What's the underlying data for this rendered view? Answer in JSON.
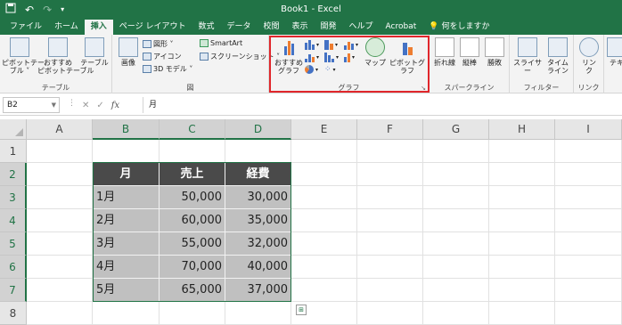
{
  "window": {
    "title": "Book1  -  Excel"
  },
  "tabs": [
    {
      "label": "ファイル"
    },
    {
      "label": "ホーム"
    },
    {
      "label": "挿入",
      "active": true
    },
    {
      "label": "ページ レイアウト"
    },
    {
      "label": "数式"
    },
    {
      "label": "データ"
    },
    {
      "label": "校閲"
    },
    {
      "label": "表示"
    },
    {
      "label": "開発"
    },
    {
      "label": "ヘルプ"
    },
    {
      "label": "Acrobat"
    },
    {
      "label": "何をしますか"
    }
  ],
  "ribbon": {
    "tables": {
      "label": "テーブル",
      "pivot": "ピボットテー\nブル ˅",
      "recommended_pivot": "おすすめ\nピボットテーブル",
      "table": "テーブル"
    },
    "illustrations": {
      "label": "図",
      "image": "画像",
      "shapes": "図形 ˅",
      "icons": "アイコン",
      "model3d": "3D モデル ˅",
      "smartart": "SmartArt",
      "screenshot": "スクリーンショット ˅"
    },
    "charts": {
      "label": "グラフ",
      "recommended": "おすすめ\nグラフ",
      "map": "マップ",
      "pivot_chart": "ピボットグラフ"
    },
    "sparklines": {
      "label": "スパークライン",
      "line": "折れ線",
      "column": "縦棒",
      "winloss": "勝敗"
    },
    "filters": {
      "label": "フィルター",
      "slicer": "スライサー",
      "timeline": "タイム\nライン"
    },
    "links": {
      "label": "リンク",
      "link": "リン\nク"
    },
    "text": {
      "label": "テキ"
    }
  },
  "formula_bar": {
    "name_box": "B2",
    "fx": "fx",
    "formula": "月"
  },
  "sheet": {
    "columns": [
      "A",
      "B",
      "C",
      "D",
      "E",
      "F",
      "G",
      "H",
      "I"
    ],
    "rows": [
      "1",
      "2",
      "3",
      "4",
      "5",
      "6",
      "7",
      "8"
    ],
    "selected_columns": [
      "B",
      "C",
      "D"
    ],
    "selected_rows": [
      "2",
      "3",
      "4",
      "5",
      "6",
      "7"
    ],
    "table": {
      "headers": [
        "月",
        "売上",
        "経費"
      ],
      "rows": [
        [
          "1月",
          "50,000",
          "30,000"
        ],
        [
          "2月",
          "60,000",
          "35,000"
        ],
        [
          "3月",
          "55,000",
          "32,000"
        ],
        [
          "4月",
          "70,000",
          "40,000"
        ],
        [
          "5月",
          "65,000",
          "37,000"
        ]
      ]
    }
  },
  "colors": {
    "accent": "#217346",
    "highlight": "#e0262b",
    "header_fill": "#4a4a4a",
    "data_fill": "#c0c0c0"
  }
}
